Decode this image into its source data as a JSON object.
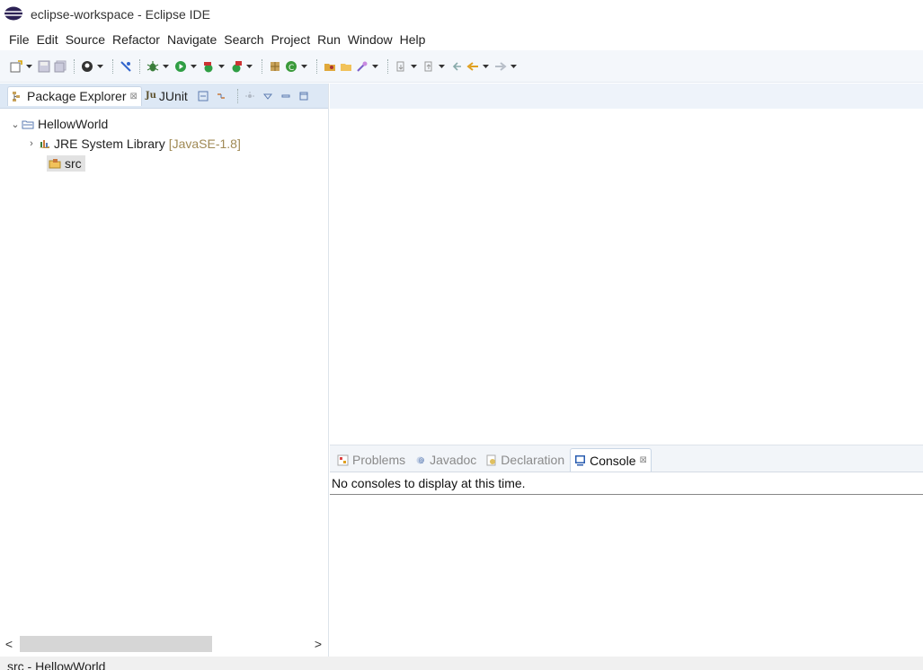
{
  "window": {
    "title": "eclipse-workspace - Eclipse IDE"
  },
  "menu": [
    "File",
    "Edit",
    "Source",
    "Refactor",
    "Navigate",
    "Search",
    "Project",
    "Run",
    "Window",
    "Help"
  ],
  "left_panel": {
    "tabs": [
      {
        "label": "Package Explorer",
        "close": "⊠"
      },
      {
        "icon_text": "Ju",
        "label": "JUnit"
      }
    ],
    "tree": {
      "project": {
        "label": "HellowWorld",
        "twisty": "⌄"
      },
      "library": {
        "label": "JRE System Library",
        "decoration": "[JavaSE-1.8]",
        "twisty": "›"
      },
      "src": {
        "label": "src"
      }
    },
    "scroll": {
      "left": "<",
      "right": ">"
    }
  },
  "bottom_panel": {
    "tabs": [
      {
        "label": "Problems"
      },
      {
        "label": "Javadoc"
      },
      {
        "label": "Declaration"
      },
      {
        "label": "Console",
        "close": "⊠"
      }
    ],
    "console_message": "No consoles to display at this time."
  },
  "status": {
    "text": "src - HellowWorld"
  },
  "colors": {
    "accent": "#2a5db0",
    "tab_strip": "#dde8f5",
    "toolbar": "#f4f7fb"
  }
}
